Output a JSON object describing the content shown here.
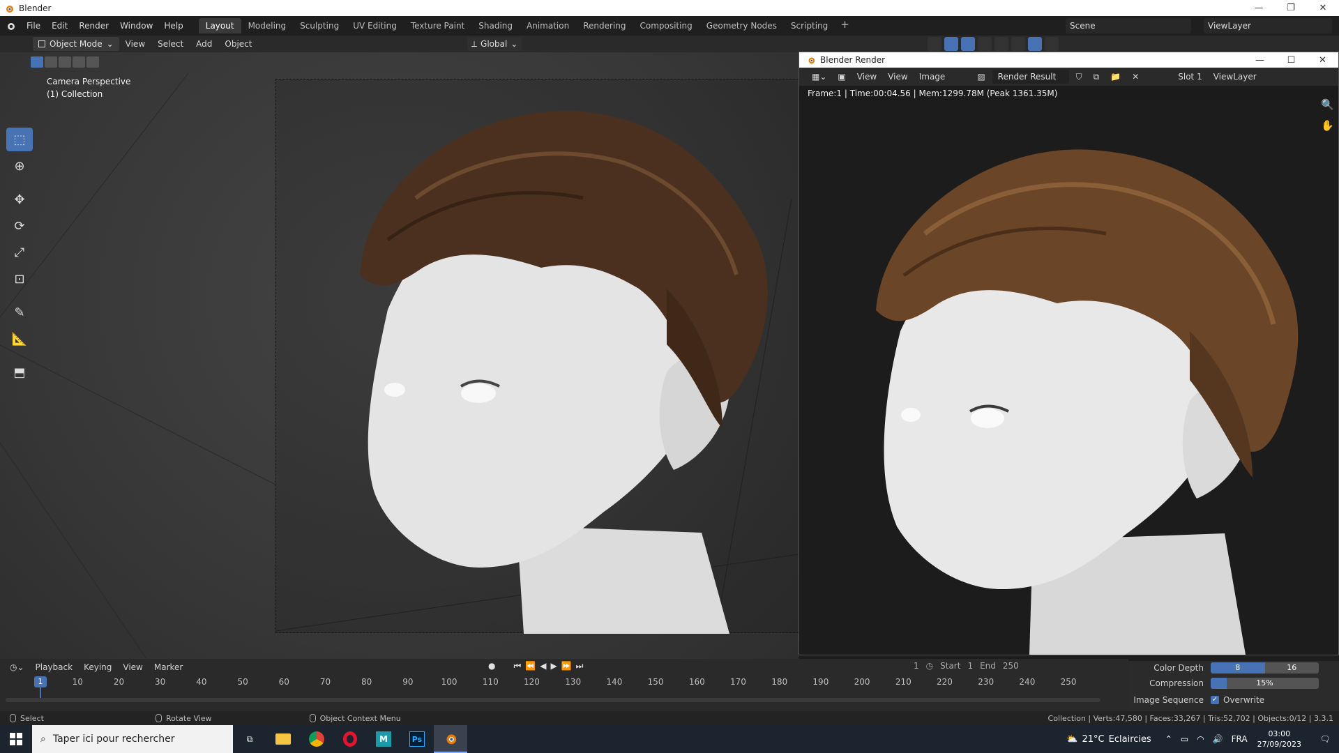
{
  "window": {
    "title": "Blender"
  },
  "menu": [
    "File",
    "Edit",
    "Render",
    "Window",
    "Help"
  ],
  "workspaces": [
    "Layout",
    "Modeling",
    "Sculpting",
    "UV Editing",
    "Texture Paint",
    "Shading",
    "Animation",
    "Rendering",
    "Compositing",
    "Geometry Nodes",
    "Scripting"
  ],
  "workspace_add": "+",
  "scene": "Scene",
  "view_layer": "ViewLayer",
  "viewport_header": {
    "mode": "Object Mode",
    "menus": [
      "View",
      "Select",
      "Add",
      "Object"
    ],
    "orientation": "Global"
  },
  "viewport": {
    "camera_label": "Camera Perspective",
    "collection_label": "(1) Collection"
  },
  "render_window": {
    "title": "Blender Render",
    "menus": [
      "View",
      "View",
      "Image"
    ],
    "image_name": "Render Result",
    "slot": "Slot 1",
    "layer": "ViewLayer",
    "info": "Frame:1 | Time:00:04.56 | Mem:1299.78M (Peak 1361.35M)"
  },
  "properties": {
    "color_depth_label": "Color Depth",
    "color_depth_options": [
      "8",
      "16"
    ],
    "compression_label": "Compression",
    "compression_value": "15%",
    "compression_fraction": 0.15,
    "image_sequence_label": "Image Sequence",
    "overwrite_label": "Overwrite"
  },
  "timeline": {
    "menus": [
      "Playback",
      "Keying",
      "View",
      "Marker"
    ],
    "current_frame": "1",
    "frame_field": "1",
    "start_label": "Start",
    "start_value": "1",
    "end_label": "End",
    "end_value": "250",
    "ticks": [
      "10",
      "20",
      "30",
      "40",
      "50",
      "60",
      "70",
      "80",
      "90",
      "100",
      "110",
      "120",
      "130",
      "140",
      "150",
      "160",
      "170",
      "180",
      "190",
      "200",
      "210",
      "220",
      "230",
      "240",
      "250"
    ]
  },
  "statusbar": {
    "select": "Select",
    "rotate": "Rotate View",
    "context": "Object Context Menu",
    "stats": "Collection | Verts:47,580 | Faces:33,267 | Tris:52,702 | Objects:0/12 | 3.3.1"
  },
  "taskbar": {
    "search_placeholder": "Taper ici pour rechercher",
    "temperature": "21°C",
    "weather": "Eclaircies",
    "language": "FRA",
    "time": "03:00",
    "date": "27/09/2023"
  },
  "colors": {
    "accent": "#4772b3",
    "hair": "#5a3a22",
    "skin": "#e6e6e6"
  }
}
